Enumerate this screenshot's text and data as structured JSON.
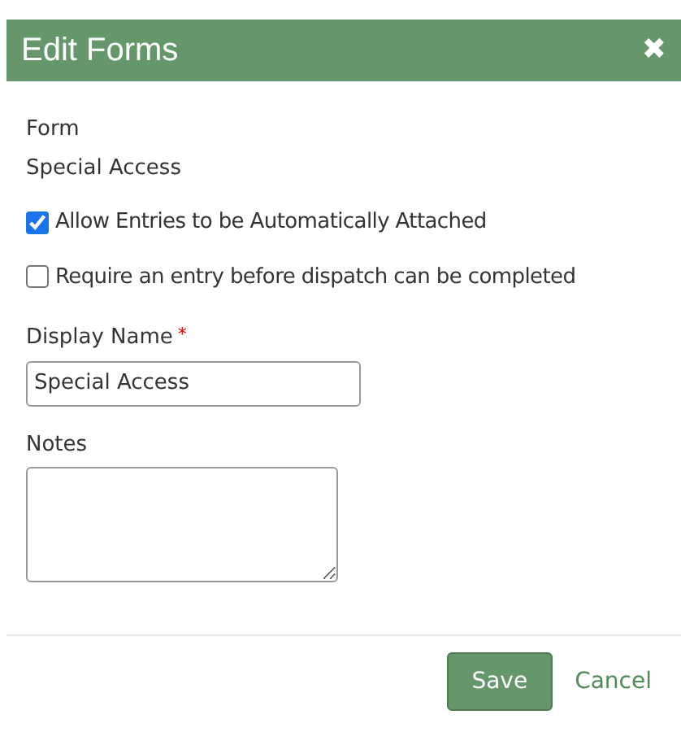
{
  "dialog": {
    "title": "Edit Forms",
    "close_icon": "✖"
  },
  "form_info": {
    "label": "Form",
    "value": "Special Access"
  },
  "options": [
    {
      "label": "Allow Entries to be Automatically Attached",
      "checked": true
    },
    {
      "label": "Require an entry before dispatch can be completed",
      "checked": false
    }
  ],
  "display_name": {
    "label": "Display Name",
    "required": true,
    "required_mark": "*",
    "value": "Special Access"
  },
  "notes": {
    "label": "Notes"
  },
  "buttons": [
    {
      "label": "Save",
      "kind": "primary"
    },
    {
      "label": "Cancel",
      "kind": "link"
    }
  ]
}
